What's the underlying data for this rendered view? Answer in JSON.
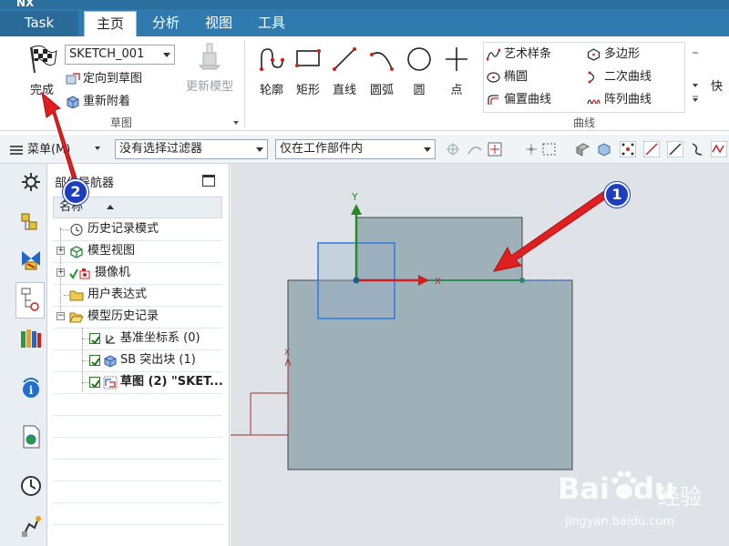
{
  "app": {
    "logo": "NX"
  },
  "tabs": [
    {
      "label": "Task"
    },
    {
      "label": "主页"
    },
    {
      "label": "分析"
    },
    {
      "label": "视图"
    },
    {
      "label": "工具"
    }
  ],
  "ribbon": {
    "finish_label": "完成",
    "sketch_name": "SKETCH_001",
    "orient_label": "定向到草图",
    "reattach_label": "重新附着",
    "update_model_label": "更新模型",
    "sketch_group_label": "草图",
    "tools": [
      {
        "label": "轮廓"
      },
      {
        "label": "矩形"
      },
      {
        "label": "直线"
      },
      {
        "label": "圆弧"
      },
      {
        "label": "圆"
      },
      {
        "label": "点"
      }
    ],
    "curve_items": [
      {
        "label": "艺术样条"
      },
      {
        "label": "多边形"
      },
      {
        "label": "椭圆"
      },
      {
        "label": "二次曲线"
      },
      {
        "label": "偏置曲线"
      },
      {
        "label": "阵列曲线"
      }
    ],
    "curve_group_label": "曲线",
    "quick_label": "快"
  },
  "selection_bar": {
    "menu_label": "菜单(M)",
    "filter_value": "没有选择过滤器",
    "scope_value": "仅在工作部件内"
  },
  "navigator": {
    "title": "部件导航器",
    "column_header": "名称",
    "nodes": [
      {
        "label": "历史记录模式"
      },
      {
        "label": "模型视图"
      },
      {
        "label": "摄像机"
      },
      {
        "label": "用户表达式"
      },
      {
        "label": "模型历史记录"
      },
      {
        "label": "基准坐标系 (0)"
      },
      {
        "label": "SB 突出块 (1)"
      },
      {
        "label": "草图 (2) \"SKET..."
      }
    ]
  },
  "graphics": {
    "axis_y_label": "Y",
    "axis_x_marker": "X"
  },
  "callouts": [
    {
      "number": "1"
    },
    {
      "number": "2"
    }
  ],
  "watermark": {
    "brand": "Bai",
    "brand_suffix": "du",
    "product": "经验",
    "url": "jingyan.baidu.com"
  },
  "colors": {
    "tab_bar": "#2f7bb0",
    "callout_blue": "#1d3fbf",
    "arrow_red": "#e02020",
    "sketch_green": "#2a8a5a",
    "body_fill": "#9fb0b8",
    "selected_blue": "#2d7be0"
  }
}
